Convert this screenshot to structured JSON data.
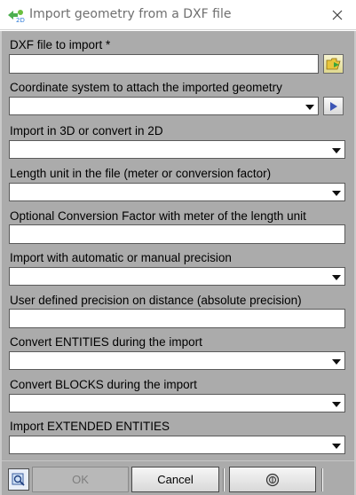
{
  "window": {
    "title": "Import geometry from a DXF file",
    "close_glyph": "✕",
    "app_icon": "import-geometry-icon"
  },
  "form": {
    "dxf_file": {
      "label": "DXF file to import *",
      "value": "",
      "browse_icon": "folder-open-icon"
    },
    "coordinate_system": {
      "label": "Coordinate system to attach the imported geometry",
      "value": "",
      "nav_icon": "play-arrow-icon"
    },
    "import_mode": {
      "label": "Import in 3D or convert in 2D",
      "value": ""
    },
    "length_unit": {
      "label": "Length unit in the file (meter or conversion factor)",
      "value": ""
    },
    "conversion_factor": {
      "label": "Optional Conversion Factor with meter of the length unit",
      "value": ""
    },
    "precision_mode": {
      "label": "Import with automatic or manual precision",
      "value": ""
    },
    "user_precision": {
      "label": "User defined precision on distance (absolute precision)",
      "value": ""
    },
    "convert_entities": {
      "label": "Convert ENTITIES during the import",
      "value": ""
    },
    "convert_blocks": {
      "label": "Convert BLOCKS during the import",
      "value": ""
    },
    "extended_entities": {
      "label": "Import EXTENDED ENTITIES",
      "value": ""
    }
  },
  "footer": {
    "ok_label": "OK",
    "cancel_label": "Cancel",
    "help_icon": "help-icon",
    "tool_icon": "zoom-preview-icon"
  },
  "colors": {
    "dialog_bg": "#ababab",
    "title_text": "#6f6f6f",
    "disabled_text": "#7e7e7e"
  }
}
